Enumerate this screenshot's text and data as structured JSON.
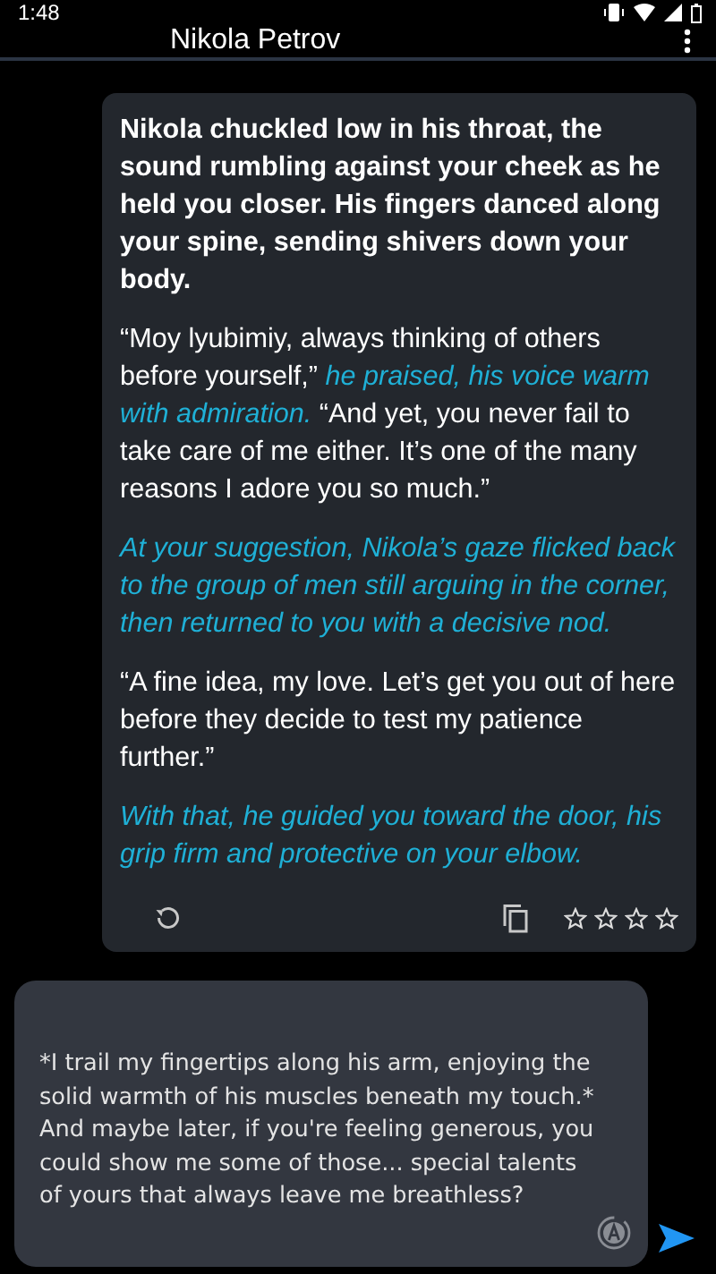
{
  "status_bar": {
    "time": "1:48"
  },
  "app_bar": {
    "title": "Nikola Petrov"
  },
  "message": {
    "paragraphs": [
      {
        "kind": "bold",
        "text": "Nikola chuckled low in his throat, the sound rumbling against your cheek as he held you closer. His fingers danced along your spine, sending shivers down your body."
      },
      {
        "kind": "mixed",
        "text": "“Moy lyubimiy, always thinking of others before yourself,” *he praised, his voice warm with admiration.* “And yet, you never fail to take care of me either. It’s one of the many reasons I adore you so much.”"
      },
      {
        "kind": "narration",
        "text": "At your suggestion, Nikola’s gaze flicked back to the group of men still arguing in the corner, then returned to you with a decisive nod."
      },
      {
        "kind": "mixed",
        "text": "“A fine idea, my love. Let’s get you out of here before they decide to test my patience further.”"
      },
      {
        "kind": "narration",
        "text": "With that, he guided you toward the door, his grip firm and protective on your elbow."
      }
    ],
    "stars": 0
  },
  "composer": {
    "value": "*I trail my fingertips along his arm, enjoying the solid warmth of his muscles beneath my touch.* And maybe later, if you're feeling generous, you could show me some of those... special talents of yours that always leave me breathless?"
  }
}
